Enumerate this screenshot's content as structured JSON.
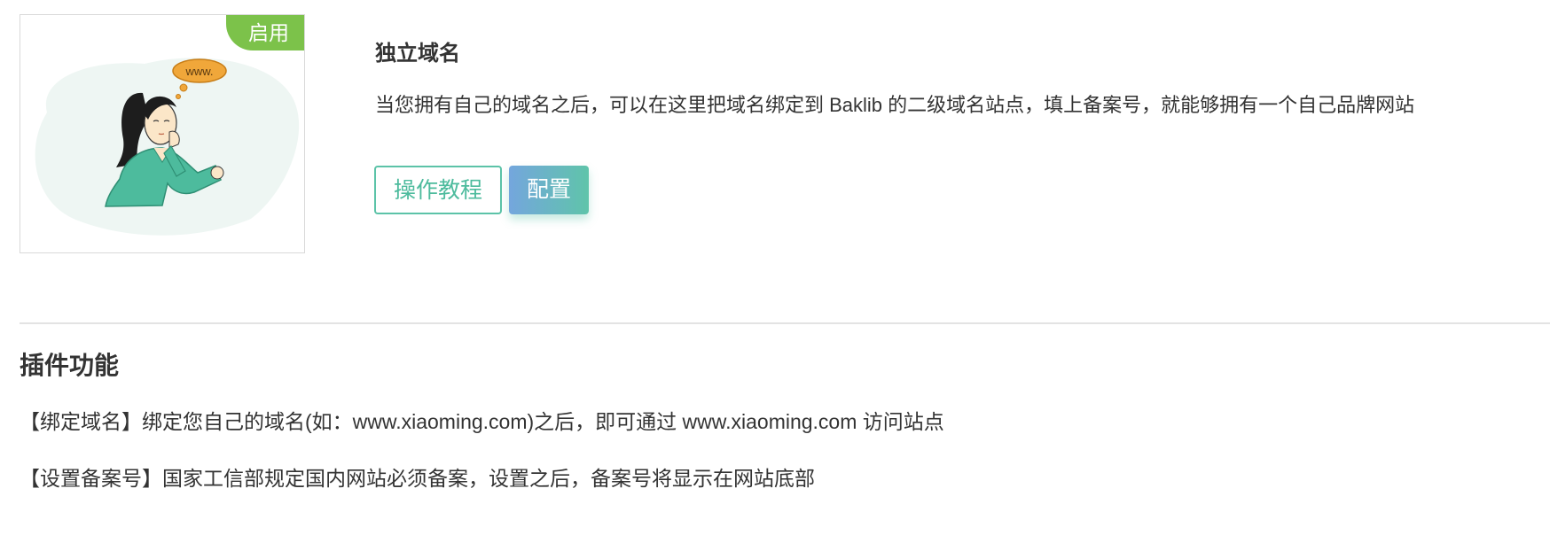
{
  "plugin": {
    "status_badge": "启用",
    "title": "独立域名",
    "description": "当您拥有自己的域名之后，可以在这里把域名绑定到 Baklib 的二级域名站点，填上备案号，就能够拥有一个自己品牌网站",
    "illustration_bubble_text": "www.",
    "buttons": {
      "tutorial_label": "操作教程",
      "config_label": "配置"
    }
  },
  "features_section": {
    "title": "插件功能",
    "items": [
      "【绑定域名】绑定您自己的域名(如：www.xiaoming.com)之后，即可通过 www.xiaoming.com 访问站点",
      "【设置备案号】国家工信部规定国内网站必须备案，设置之后，备案号将显示在网站底部"
    ]
  },
  "colors": {
    "badge_green": "#7cc24a",
    "accent_teal": "#4dbb9d",
    "config_gradient_start": "#74a6dd",
    "config_gradient_end": "#5fc4aa",
    "text": "#333333",
    "divider": "#e3e3e3"
  },
  "icons": {
    "illustration": "thinking-woman-illustration",
    "thought_bubble": "thought-bubble-icon"
  }
}
